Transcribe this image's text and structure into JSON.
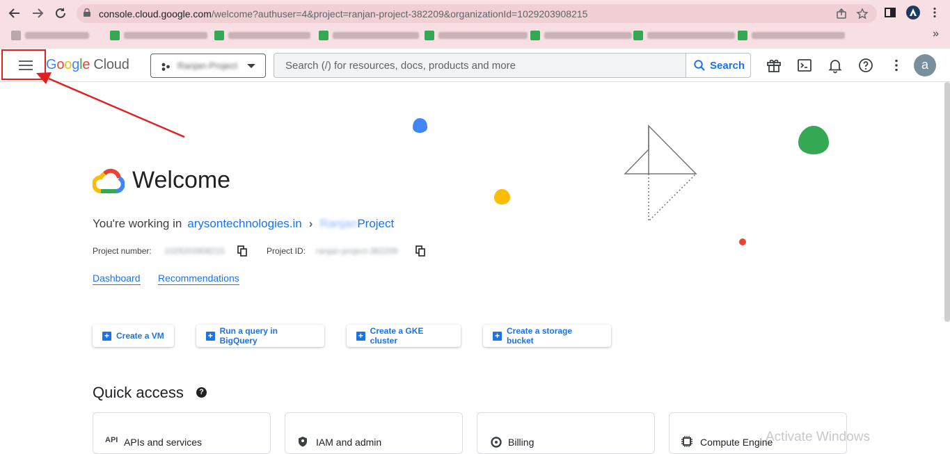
{
  "browser": {
    "url_host": "console.cloud.google.com",
    "url_path": "/welcome?authuser=4&project=ranjan-project-382209&organizationId=1029203908215",
    "more_bookmarks": "»",
    "account_initial": "a"
  },
  "header": {
    "logo_google": [
      "G",
      "o",
      "o",
      "g",
      "l",
      "e"
    ],
    "logo_cloud": "Cloud",
    "project_name": "Ranjan-Project",
    "search_placeholder": "Search (/) for resources, docs, products and more",
    "search_button": "Search",
    "avatar_initial": "a"
  },
  "welcome": {
    "title": "Welcome",
    "working_in": "You're working in",
    "organization": "arysontechnologies.in",
    "separator": "›",
    "project_blur": "Ranjan",
    "project_suffix": "Project",
    "project_number_label": "Project number:",
    "project_number_value": "1029203908215",
    "project_id_label": "Project ID:",
    "project_id_value": "ranjan-project-382209"
  },
  "links": {
    "dashboard": "Dashboard",
    "recommendations": "Recommendations"
  },
  "actions": [
    {
      "label": "Create a VM"
    },
    {
      "label": "Run a query in BigQuery"
    },
    {
      "label": "Create a GKE cluster"
    },
    {
      "label": "Create a storage bucket"
    }
  ],
  "quick_access": {
    "title": "Quick access",
    "help": "?",
    "cards": [
      {
        "icon": "API",
        "label": "APIs and services"
      },
      {
        "icon": "iam",
        "label": "IAM and admin"
      },
      {
        "icon": "billing",
        "label": "Billing"
      },
      {
        "icon": "compute",
        "label": "Compute Engine"
      }
    ]
  },
  "watermark": "Activate Windows",
  "colors": {
    "accent": "#1a73e8",
    "annotation": "#e02020",
    "chrome_bg": "#f8dfe3"
  }
}
